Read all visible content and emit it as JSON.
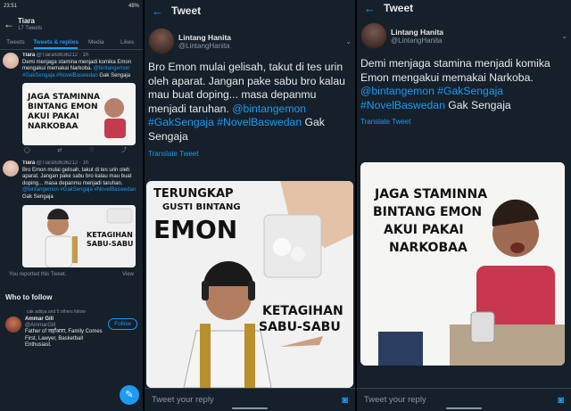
{
  "panel1": {
    "status_time": "23:51",
    "status_right": "48%",
    "profile_name": "Tiara",
    "profile_count": "17 Tweets",
    "tabs": [
      "Tweets",
      "Tweets & replies",
      "Media",
      "Likes"
    ],
    "tweets": [
      {
        "name": "Tiara",
        "handle": "@Tiara63636212 · 1h",
        "text_plain": "Demi menjaga stamina menjadi komika Emon mengakui memakai Narkoba. ",
        "mention": "@bintangemon",
        "hashtags": "#GakSengaja #NovelBaswedan",
        "tail": " Gak Sengaja",
        "image_caption": "JAGA STAMINNA BINTANG EMON AKUI PAKAI NARKOBAA"
      },
      {
        "name": "Tiara",
        "handle": "@Tiara63636212 · 1h",
        "text_plain": "Bro Emon mulai gelisah, takut di tes urin oleh aparat. Jangan pake sabu bro kalau mau buat doping... masa depanmu menjadi taruhan. ",
        "mention": "@bintangemon",
        "hashtags": "#GakSengaja #NovelBaswedan",
        "tail": " Gak Sengaja",
        "image_caption": "KETAGIHAN SABU-SABU"
      }
    ],
    "reported_text": "You reported this Tweet.",
    "reported_link": "View",
    "who_to_follow": "Who to follow",
    "follow_note": "cak aditya and 5 others follow",
    "suggestion": {
      "name": "Ammar Gill",
      "handle": "@AmmarGill",
      "bio": "Father of जहाँआरा, Family Comes First, Lawyer, Basketball Enthusiast.",
      "button": "Follow"
    },
    "fab_icon": "compose-icon"
  },
  "panel2": {
    "header": "Tweet",
    "author_name": "Lintang Hanita",
    "author_handle": "@LintangHanita",
    "text_plain": "Bro Emon mulai gelisah, takut di tes urin oleh aparat. Jangan pake sabu bro kalau mau buat doping... masa depanmu menjadi taruhan.",
    "links": "@bintangemon #GakSengaja #NovelBaswedan",
    "tail": " Gak Sengaja",
    "translate": "Translate Tweet",
    "image_headline_1": "TERUNGKAP",
    "image_headline_2": "GUSTI BINTANG",
    "image_headline_3": "EMON",
    "image_caption": "KETAGIHAN SABU-SABU",
    "reply_placeholder": "Tweet your reply"
  },
  "panel3": {
    "header": "Tweet",
    "author_name": "Lintang Hanita",
    "author_handle": "@LintangHanita",
    "text_plain": "Demi menjaga stamina menjadi komika Emon mengakui memakai Narkoba. ",
    "links": "@bintangemon #GakSengaja #NovelBaswedan",
    "tail": " Gak Sengaja",
    "translate": "Translate Tweet",
    "image_caption_1": "JAGA STAMINNA",
    "image_caption_2": "BINTANG EMON",
    "image_caption_3": "AKUI PAKAI",
    "image_caption_4": "NARKOBAA",
    "reply_placeholder": "Tweet your reply"
  },
  "colors": {
    "background": "#15202b",
    "accent": "#1d9bf0",
    "muted": "#8899a6"
  }
}
